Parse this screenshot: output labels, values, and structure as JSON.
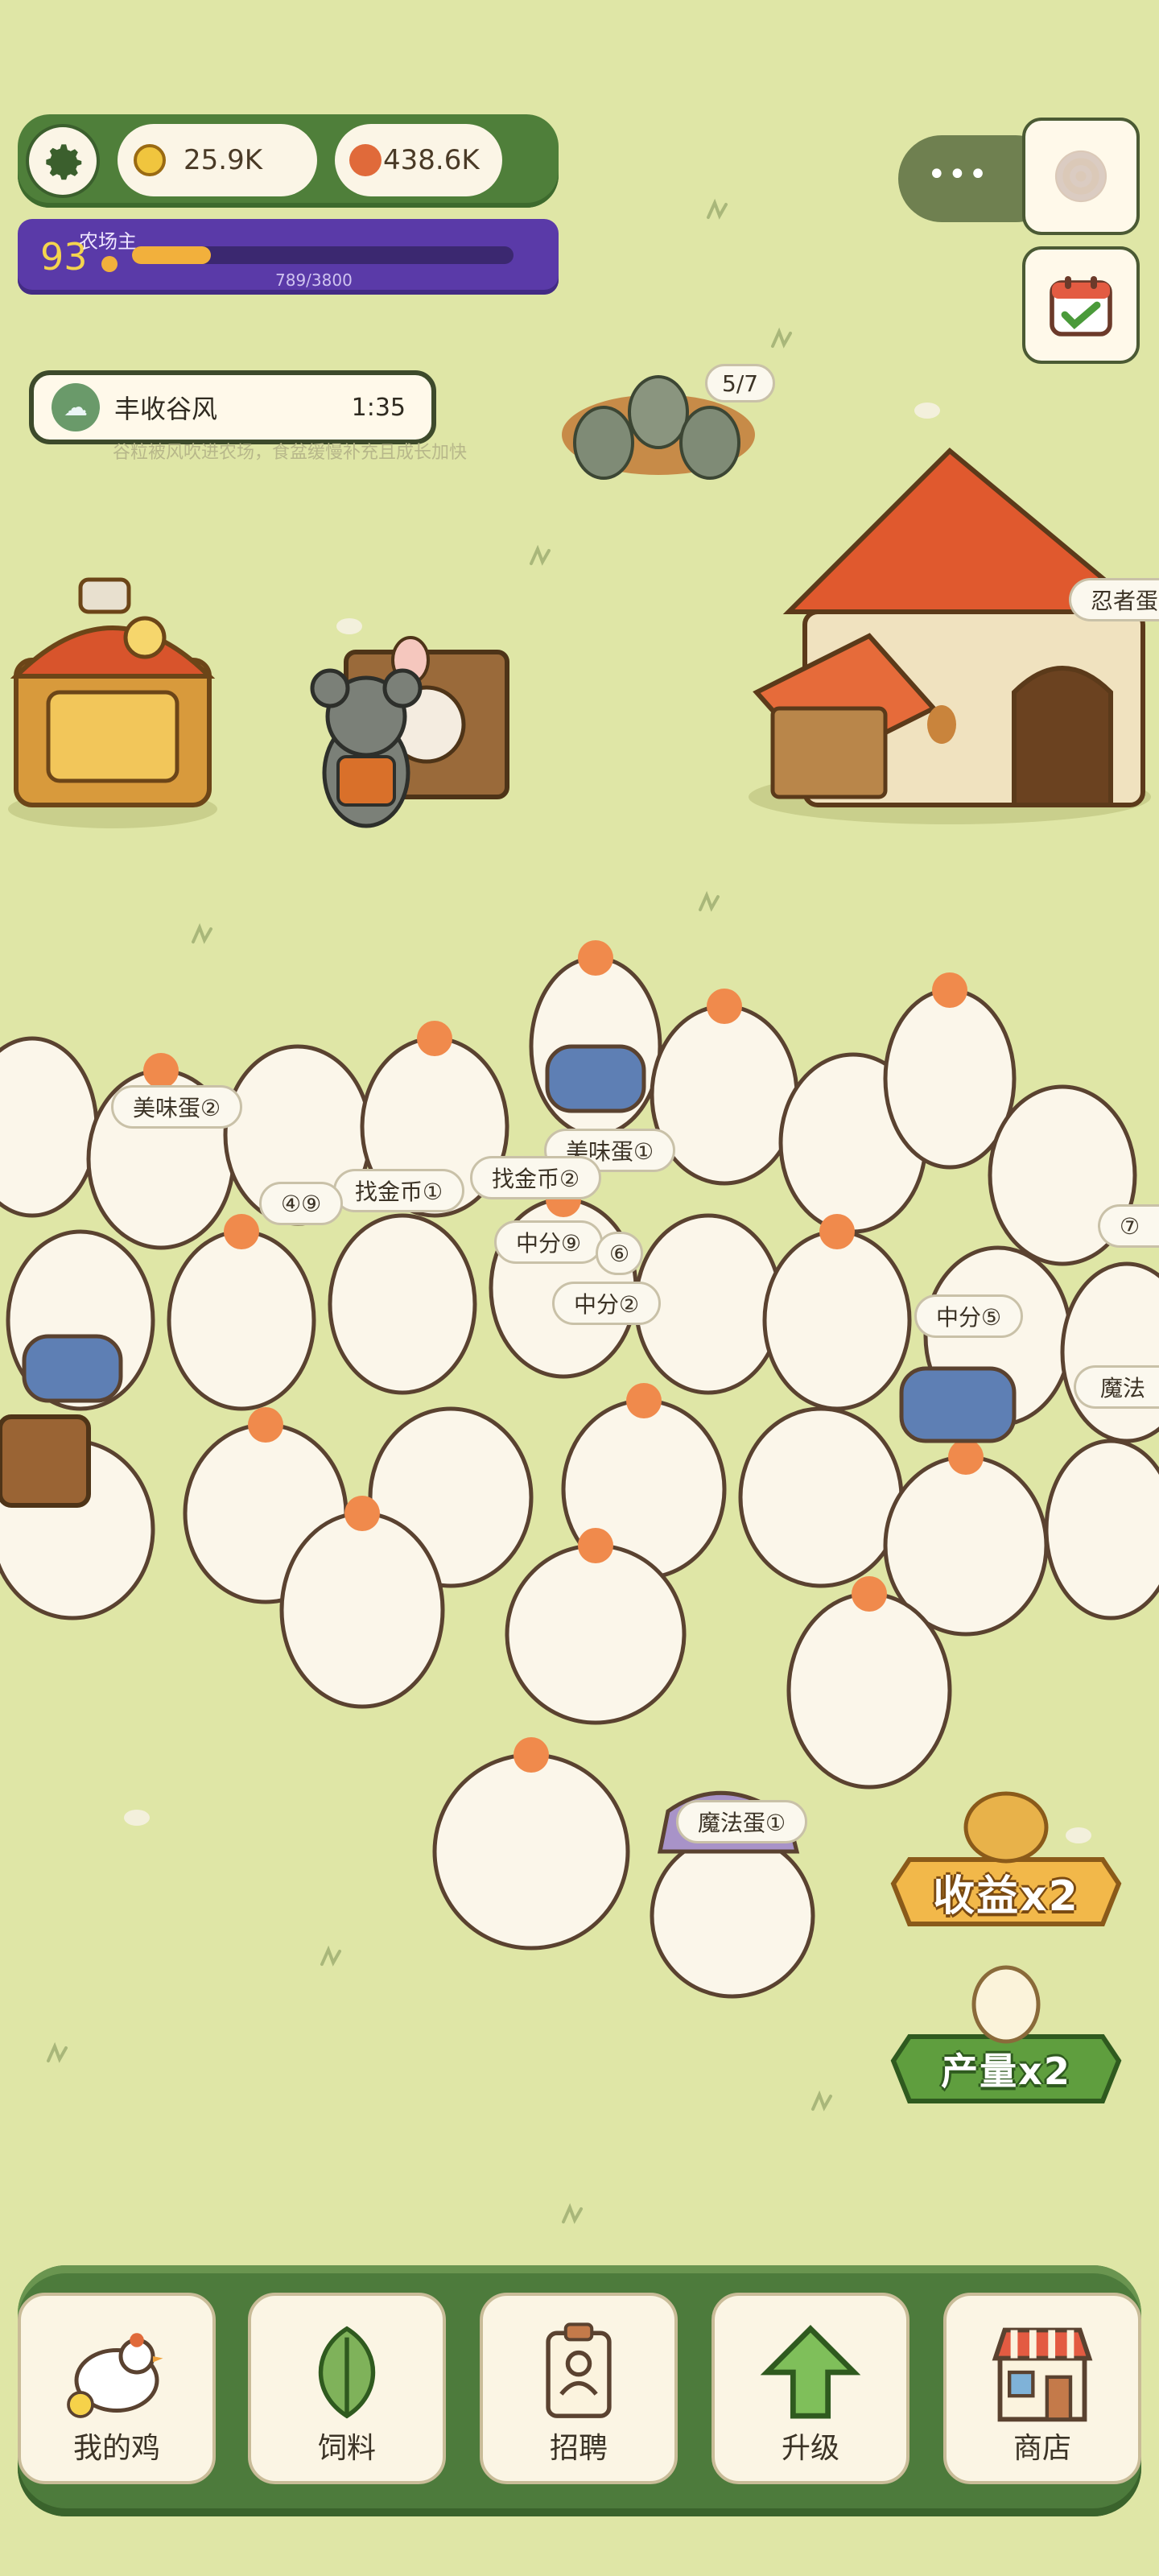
{
  "colors": {
    "grass": "#dfe6a6",
    "hud_green": "#4f7f3a",
    "level_purple": "#5a3aa8",
    "progress_orange": "#f2b03c",
    "nav_green": "#4d7b3c"
  },
  "hud": {
    "settings_icon": "gear-icon",
    "coins": "25.9K",
    "coin_icon": "coin-icon",
    "eggs": "438.6K",
    "egg_icon": "orange-dot-icon"
  },
  "level": {
    "number": "93",
    "title": "农场主",
    "progress_text": "789/3800",
    "progress": 0.2076
  },
  "event": {
    "icon": "wind-icon",
    "name": "丰收谷风",
    "timer": "1:35",
    "description": "谷粒被风吹进农场，食盆缓慢补充且成长加快"
  },
  "nest": {
    "count": "5/7"
  },
  "coop": {
    "label": "忍者蛋"
  },
  "menu": {
    "dots": "•••",
    "target_icon": "target-icon"
  },
  "calendar_icon": "calendar-check-icon",
  "chicken_labels": [
    "美味蛋②",
    "美味蛋①",
    "找金币②",
    "找金币①",
    "④⑨",
    "中分⑨",
    "⑥",
    "中分②",
    "中分⑤",
    "⑦",
    "魔法",
    "魔法蛋①"
  ],
  "boosts": {
    "income": "收益x2",
    "output": "产量x2"
  },
  "nav": [
    {
      "label": "我的鸡",
      "icon": "chicken-icon"
    },
    {
      "label": "饲料",
      "icon": "leaf-icon"
    },
    {
      "label": "招聘",
      "icon": "badge-icon"
    },
    {
      "label": "升级",
      "icon": "arrow-up-icon"
    },
    {
      "label": "商店",
      "icon": "shop-icon"
    }
  ]
}
